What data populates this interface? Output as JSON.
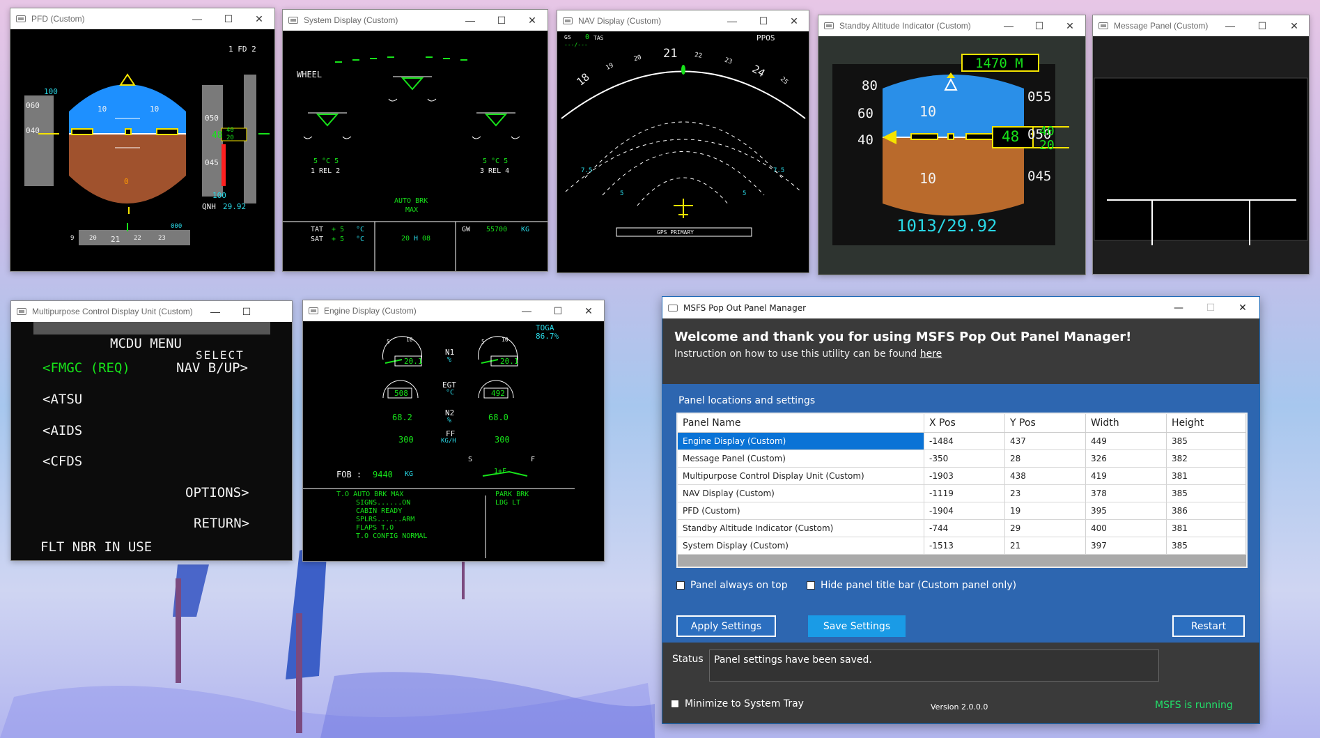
{
  "pfd": {
    "title": "PFD (Custom)",
    "fd": "1 FD 2",
    "spd_top": "100",
    "spd_060": "060",
    "spd_040": "040",
    "pitch_10_l": "10",
    "pitch_10_r": "10",
    "alt_050": "050",
    "alt_045": "045",
    "alt_value": "48",
    "alt_40": "40",
    "alt_20": "20",
    "alt_sub_100": "100",
    "qnh_label": "QNH",
    "qnh_value": "29.92",
    "hdg_ticks": [
      "9",
      "20",
      "21",
      "22",
      "23"
    ],
    "hdg_000": "000",
    "vs_0": "0"
  },
  "sysdisp": {
    "title": "System Display (Custom)",
    "wheel": "WHEEL",
    "left_temp": "5 °C 5",
    "left_rel": "1 REL 2",
    "right_temp": "5 °C 5",
    "right_rel": "3 REL 4",
    "autobrk": "AUTO BRK",
    "max": "MAX",
    "tat_label": "TAT",
    "tat_val": "+ 5",
    "sat_label": "SAT",
    "sat_val": "+ 5",
    "deg_c": "°C",
    "time_h": "20",
    "time_sep": "H",
    "time_m": "08",
    "gw_label": "GW",
    "gw_val": "55700",
    "gw_unit": "KG"
  },
  "nav": {
    "title": "NAV Display (Custom)",
    "gs": "GS",
    "gs_val": "0",
    "tas": "TAS",
    "tas_val": "---/---",
    "ppos": "PPOS",
    "hdg_labels": [
      "18",
      "19",
      "20",
      "21",
      "22",
      "23",
      "24",
      "25"
    ],
    "rng_75l": "7.5",
    "rng_75r": "7.5",
    "rng_5l": "5",
    "rng_5r": "5",
    "gps": "GPS PRIMARY"
  },
  "standby": {
    "title": "Standby Altitude Indicator (Custom)",
    "metric": "1470 M",
    "spd_top": "80",
    "spd_60": "60",
    "spd_40": "40",
    "pitch_10_up": "10",
    "pitch_10_dn": "10",
    "alt_055": "055",
    "alt_050": "050",
    "alt_045": "045",
    "alt_box": "48",
    "alt_40": "40",
    "alt_20": "20",
    "baro": "1013/29.92"
  },
  "msg": {
    "title": "Message Panel (Custom)"
  },
  "mcdu": {
    "title": "Multipurpose Control Display Unit (Custom)",
    "menu": "MCDU MENU",
    "select": "SELECT",
    "fmgc": "<FMGC (REQ)",
    "navbup": "NAV B/UP>",
    "atsu": "<ATSU",
    "aids": "<AIDS",
    "cfds": "<CFDS",
    "options": "OPTIONS>",
    "return": "RETURN>",
    "flt": "FLT NBR IN USE"
  },
  "engine": {
    "title": "Engine Display (Custom)",
    "toga": "TOGA",
    "toga_val": "86.7%",
    "n1": "N1",
    "pct": "%",
    "n1_l": "20.1",
    "n1_r": "20.1",
    "egt": "EGT",
    "degc": "°C",
    "egt_l": "508",
    "egt_r": "492",
    "n2": "N2",
    "n2_l": "68.2",
    "n2_r": "68.0",
    "ff": "FF",
    "ffunit": "KG/H",
    "ff_l": "300",
    "ff_r": "300",
    "fob_label": "FOB :",
    "fob_val": "9440",
    "fob_unit": "KG",
    "flap_s": "S",
    "flap_f": "F",
    "flap_pos": "1+F",
    "memo_l": [
      "T.O AUTO BRK MAX",
      "SIGNS......ON",
      "CABIN READY",
      "SPLRS......ARM",
      "FLAPS T.O",
      "T.O CONFIG NORMAL"
    ],
    "memo_r": [
      "PARK BRK",
      "LDG LT"
    ],
    "gauge_small_l": [
      "5",
      "10"
    ],
    "gauge_small_r": [
      "5",
      "10"
    ]
  },
  "manager": {
    "title": "MSFS Pop Out Panel Manager",
    "welcome": "Welcome and thank you for using MSFS Pop Out Panel Manager!",
    "instruction": "Instruction on how to use this utility can be found",
    "here": "here",
    "section": "Panel locations and settings",
    "columns": [
      "Panel Name",
      "X Pos",
      "Y Pos",
      "Width",
      "Height"
    ],
    "rows": [
      [
        "Engine Display (Custom)",
        "-1484",
        "437",
        "449",
        "385"
      ],
      [
        "Message Panel (Custom)",
        "-350",
        "28",
        "326",
        "382"
      ],
      [
        "Multipurpose Control Display Unit (Custom)",
        "-1903",
        "438",
        "419",
        "381"
      ],
      [
        "NAV Display (Custom)",
        "-1119",
        "23",
        "378",
        "385"
      ],
      [
        "PFD (Custom)",
        "-1904",
        "19",
        "395",
        "386"
      ],
      [
        "Standby Altitude Indicator (Custom)",
        "-744",
        "29",
        "400",
        "381"
      ],
      [
        "System Display (Custom)",
        "-1513",
        "21",
        "397",
        "385"
      ]
    ],
    "always_on_top": "Panel always on top",
    "hide_title": "Hide panel title bar (Custom panel only)",
    "apply": "Apply Settings",
    "save": "Save Settings",
    "restart": "Restart",
    "status_label": "Status",
    "status_value": "Panel settings have been saved.",
    "minimize": "Minimize to System Tray",
    "version": "Version 2.0.0.0",
    "running": "MSFS is running"
  },
  "window_controls": {
    "min": "—",
    "max": "☐",
    "close": "✕"
  },
  "colors": {
    "accent": "#2d66b0",
    "selected": "#0a73d6",
    "running": "#22e06a",
    "sky": "#1e90ff",
    "ground": "#a0522d"
  }
}
